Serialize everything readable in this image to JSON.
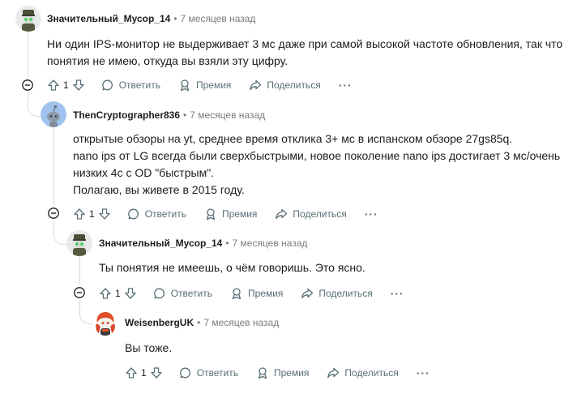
{
  "actions": {
    "reply": "Ответить",
    "award": "Премия",
    "share": "Поделиться",
    "more": "···"
  },
  "comments": [
    {
      "author": "Значительный_Мусор_14",
      "separator": "•",
      "time": "7 месяцев назад",
      "lines": [
        "Ни один IPS-монитор не выдерживает 3 мс даже при самой высокой частоте обновления, так что",
        "понятия не имею, откуда вы взяли эту цифру."
      ],
      "votes": "1",
      "avatar": "robot-soldier-avatar"
    },
    {
      "author": "ThenCryptographer836",
      "separator": "•",
      "time": "7 месяцев назад",
      "lines": [
        "открытые обзоры на yt, среднее время отклика 3+ мс в испанском обзоре 27gs85q.",
        "nano ips от LG всегда были сверхбыстрыми, новое поколение nano ips достигает 3 мс/очень",
        "низких 4с с OD \"быстрым\".",
        "Полагаю, вы живете в 2015 году."
      ],
      "votes": "1",
      "avatar": "default-snoo-avatar"
    },
    {
      "author": "Значительный_Мусор_14",
      "separator": "•",
      "time": "7 месяцев назад",
      "lines": [
        "Ты понятия не имеешь, о чём говоришь. Это ясно."
      ],
      "votes": "1",
      "avatar": "robot-soldier-avatar"
    },
    {
      "author": "WeisenbergUK",
      "separator": "•",
      "time": "7 месяцев назад",
      "lines": [
        "Вы тоже."
      ],
      "votes": "1",
      "avatar": "red-hair-snoo-avatar"
    }
  ]
}
